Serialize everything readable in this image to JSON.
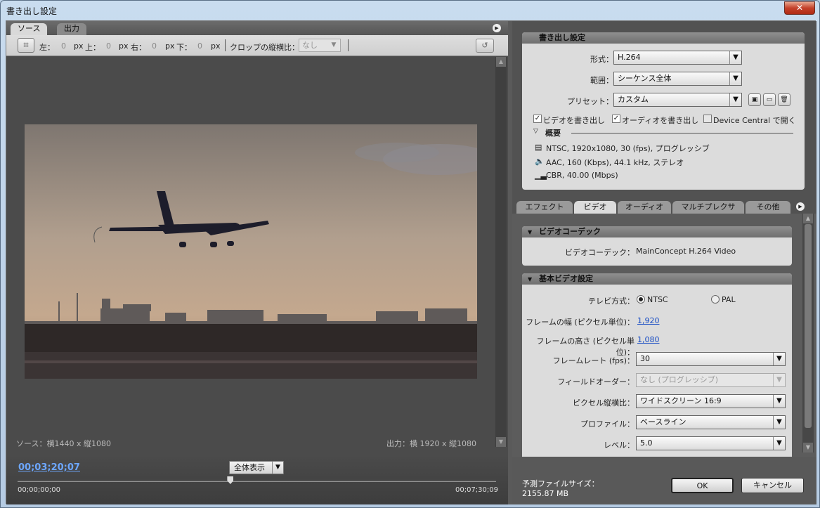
{
  "window": {
    "title": "書き出し設定",
    "close": "✕"
  },
  "source_panel": {
    "tabs": [
      {
        "label": "ソース"
      },
      {
        "label": "出力"
      }
    ],
    "toolbar": {
      "crop_icon": "crop-icon",
      "left_label": "左：",
      "left_value": "0",
      "unit1": "px",
      "top_label": "上：",
      "top_value": "0",
      "unit2": "px",
      "right_label": "右：",
      "right_value": "0",
      "unit3": "px",
      "bottom_label": "下：",
      "bottom_value": "0",
      "unit4": "px",
      "aspect_label": "クロップの縦横比：",
      "aspect_value": "なし"
    },
    "source_info": "ソース：横1440 x 縦1080",
    "output_info": "出力：横 1920 x 縦1080",
    "timecode": "00;03;20;07",
    "zoom": "全体表示",
    "time_start": "00;00;00;00",
    "time_end": "00;07;30;09",
    "playhead_fraction": 0.444
  },
  "export_settings": {
    "header": "書き出し設定",
    "format_label": "形式：",
    "format_value": "H.264",
    "range_label": "範囲：",
    "range_value": "シーケンス全体",
    "preset_label": "プリセット：",
    "preset_value": "カスタム",
    "export_video": "ビデオを書き出し",
    "export_audio": "オーディオを書き出し",
    "device_central": "Device Central で開く",
    "summary_label": "概要",
    "summary_video": "NTSC, 1920x1080, 30 (fps), プログレッシブ",
    "summary_audio": "AAC, 160 (Kbps), 44.1 kHz, ステレオ",
    "summary_bitrate": "CBR, 40.00 (Mbps)"
  },
  "tabs": [
    {
      "label": "エフェクト"
    },
    {
      "label": "ビデオ"
    },
    {
      "label": "オーディオ"
    },
    {
      "label": "マルチプレクサ"
    },
    {
      "label": "その他"
    }
  ],
  "video_codec": {
    "header": "ビデオコーデック",
    "label": "ビデオコーデック：",
    "value": "MainConcept H.264 Video"
  },
  "basic_video": {
    "header": "基本ビデオ設定",
    "tv_label": "テレビ方式：",
    "ntsc": "NTSC",
    "pal": "PAL",
    "width_label": "フレームの幅 (ピクセル単位)：",
    "width_value": "1,920",
    "height_label": "フレームの高さ (ピクセル単位)：",
    "height_value": "1,080",
    "framerate_label": "フレームレート (fps)：",
    "framerate_value": "30",
    "field_label": "フィールドオーダー：",
    "field_value": "なし (プログレッシブ)",
    "pixel_label": "ピクセル縦横比：",
    "pixel_value": "ワイドスクリーン 16:9",
    "profile_label": "プロファイル：",
    "profile_value": "ベースライン",
    "level_label": "レベル：",
    "level_value": "5.0"
  },
  "footer": {
    "estimate_label": "予測ファイルサイズ：",
    "estimate_value": "2155.87 MB",
    "ok": "OK",
    "cancel": "キャンセル"
  }
}
